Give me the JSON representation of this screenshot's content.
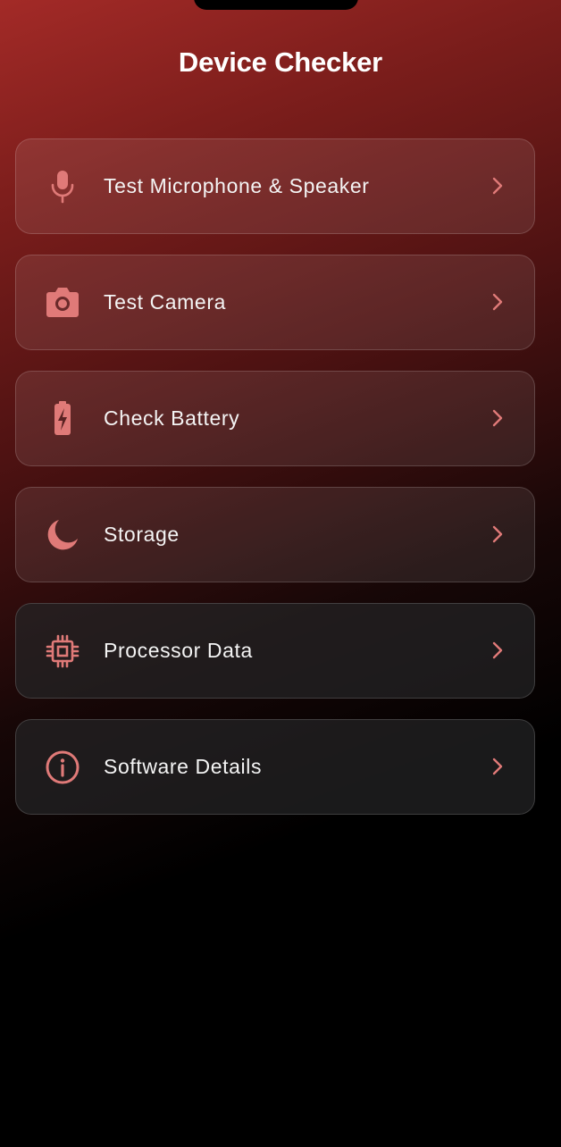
{
  "app": {
    "title": "Device Checker"
  },
  "theme": {
    "accent": "#e07a78",
    "text": "#f4f4f4"
  },
  "menu": {
    "items": [
      {
        "label": "Test Microphone & Speaker",
        "icon": "microphone-icon"
      },
      {
        "label": "Test Camera",
        "icon": "camera-icon"
      },
      {
        "label": "Check Battery",
        "icon": "battery-charging-icon"
      },
      {
        "label": "Storage",
        "icon": "moon-icon"
      },
      {
        "label": "Processor Data",
        "icon": "cpu-chip-icon"
      },
      {
        "label": "Software Details",
        "icon": "info-icon"
      }
    ]
  }
}
